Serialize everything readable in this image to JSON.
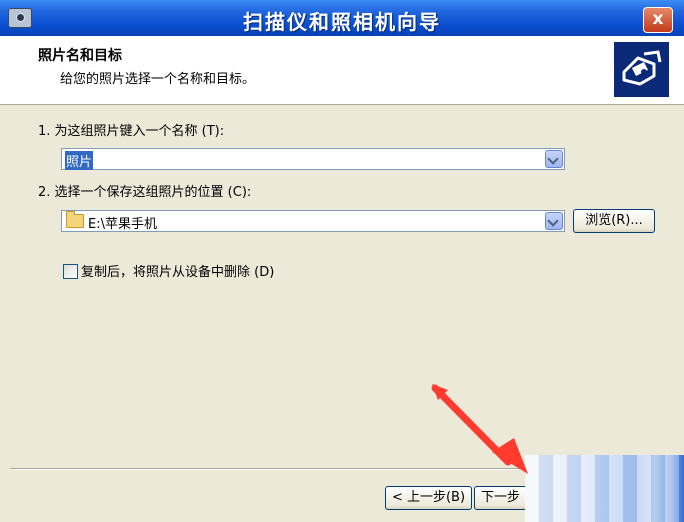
{
  "window": {
    "title": "扫描仪和照相机向导",
    "close_label": "x"
  },
  "header": {
    "title": "照片名和目标",
    "subtitle": "给您的照片选择一个名称和目标。",
    "icon": "camera-wizard-icon"
  },
  "step1": {
    "label": "1. 为这组照片键入一个名称 (T):",
    "value": "照片"
  },
  "step2": {
    "label": "2. 选择一个保存这组照片的位置 (C):",
    "value": "E:\\苹果手机",
    "browse_label": "浏览(R)..."
  },
  "delete_option": {
    "label": "复制后，将照片从设备中删除 (D)",
    "checked": false
  },
  "footer": {
    "back_label": "< 上一步(B)",
    "next_label": "下一步"
  },
  "colors": {
    "title_bar": "#0b4fd1",
    "arrow": "#ff3b2f",
    "selection": "#316ac5"
  }
}
